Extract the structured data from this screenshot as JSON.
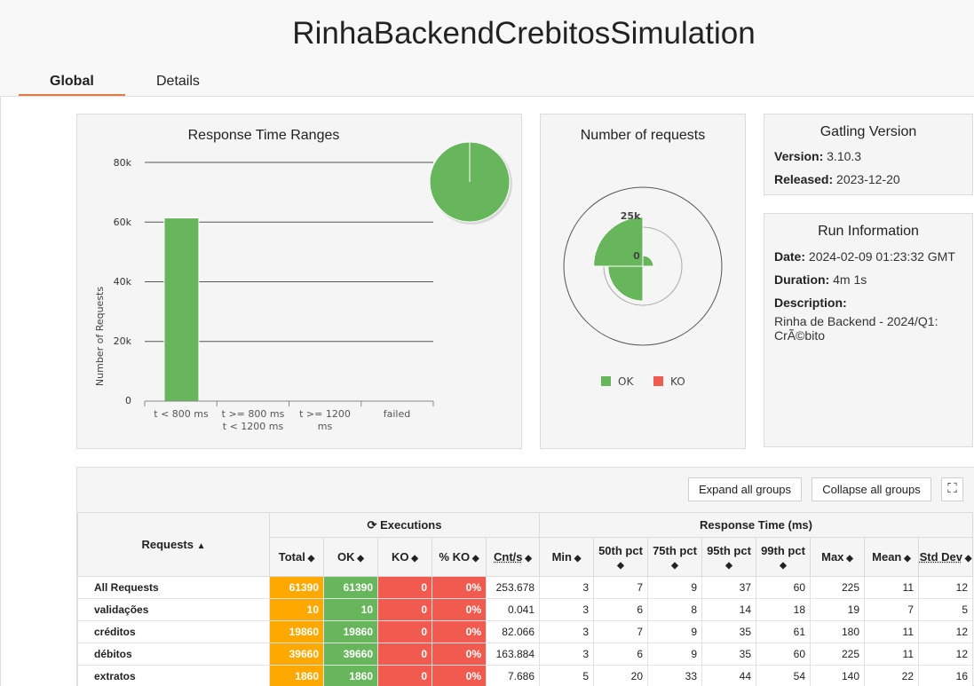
{
  "header": {
    "title": "RinhaBackendCrebitosSimulation",
    "tabs": [
      {
        "label": "Global",
        "active": true
      },
      {
        "label": "Details",
        "active": false
      }
    ]
  },
  "response_time_ranges": {
    "title": "Response Time Ranges",
    "ylabel": "Number of Requests",
    "yticks": [
      "80k",
      "60k",
      "40k",
      "20k",
      "0"
    ],
    "categories": [
      [
        "t < 800 ms"
      ],
      [
        "t >= 800 ms",
        "t < 1200 ms"
      ],
      [
        "t >= 1200",
        "ms"
      ],
      [
        "failed"
      ]
    ]
  },
  "chart_data": [
    {
      "type": "bar",
      "title": "Response Time Ranges",
      "ylabel": "Number of Requests",
      "categories": [
        "t < 800 ms",
        "t >= 800 ms t < 1200 ms",
        "t >= 1200 ms",
        "failed"
      ],
      "values": [
        61390,
        0,
        0,
        0
      ],
      "ylim": [
        0,
        80000
      ],
      "grid": true
    },
    {
      "type": "pie",
      "labels": [
        "t < 800 ms",
        "t >= 800 ms t < 1200 ms",
        "t >= 1200 ms",
        "failed"
      ],
      "values": [
        61390,
        0,
        0,
        0
      ],
      "colors": [
        "#68b65c",
        "#ffdd00",
        "#ffa900",
        "#f15b4f"
      ]
    },
    {
      "type": "area",
      "title": "Number of requests",
      "series": [
        {
          "name": "OK",
          "values": [
            1860,
            10,
            19860,
            39660
          ]
        },
        {
          "name": "KO",
          "values": [
            0,
            0,
            0,
            0
          ]
        }
      ],
      "rticks": [
        "0",
        "25k"
      ],
      "legend": "bottom"
    }
  ],
  "number_of_requests": {
    "title": "Number of requests",
    "rticks": [
      "0",
      "25k"
    ],
    "legend": [
      {
        "label": "OK",
        "color": "#68b65c"
      },
      {
        "label": "KO",
        "color": "#f15b4f"
      }
    ]
  },
  "gatling": {
    "title": "Gatling Version",
    "version_label": "Version:",
    "version": "3.10.3",
    "released_label": "Released:",
    "released": "2023-12-20"
  },
  "run_info": {
    "title": "Run Information",
    "date_label": "Date:",
    "date": "2024-02-09 01:23:32 GMT",
    "duration_label": "Duration:",
    "duration": "4m 1s",
    "description_label": "Description:",
    "description": "Rinha de Backend - 2024/Q1: CrÃ©bito"
  },
  "stats": {
    "expand_label": "Expand all groups",
    "collapse_label": "Collapse all groups",
    "requests_header": "Requests",
    "executions_header": "Executions",
    "response_time_header": "Response Time (ms)",
    "columns": [
      "Total",
      "OK",
      "KO",
      "% KO",
      "Cnt/s",
      "Min",
      "50th pct",
      "75th pct",
      "95th pct",
      "99th pct",
      "Max",
      "Mean",
      "Std Dev"
    ],
    "rows": [
      {
        "name": "All Requests",
        "cells": [
          "61390",
          "61390",
          "0",
          "0%",
          "253.678",
          "3",
          "7",
          "9",
          "37",
          "60",
          "225",
          "11",
          "12"
        ]
      },
      {
        "name": "validações",
        "cells": [
          "10",
          "10",
          "0",
          "0%",
          "0.041",
          "3",
          "6",
          "8",
          "14",
          "18",
          "19",
          "7",
          "5"
        ]
      },
      {
        "name": "créditos",
        "cells": [
          "19860",
          "19860",
          "0",
          "0%",
          "82.066",
          "3",
          "7",
          "9",
          "35",
          "61",
          "180",
          "11",
          "12"
        ]
      },
      {
        "name": "débitos",
        "cells": [
          "39660",
          "39660",
          "0",
          "0%",
          "163.884",
          "3",
          "6",
          "9",
          "35",
          "60",
          "225",
          "11",
          "12"
        ]
      },
      {
        "name": "extratos",
        "cells": [
          "1860",
          "1860",
          "0",
          "0%",
          "7.686",
          "5",
          "20",
          "33",
          "44",
          "54",
          "140",
          "22",
          "16"
        ]
      }
    ]
  }
}
